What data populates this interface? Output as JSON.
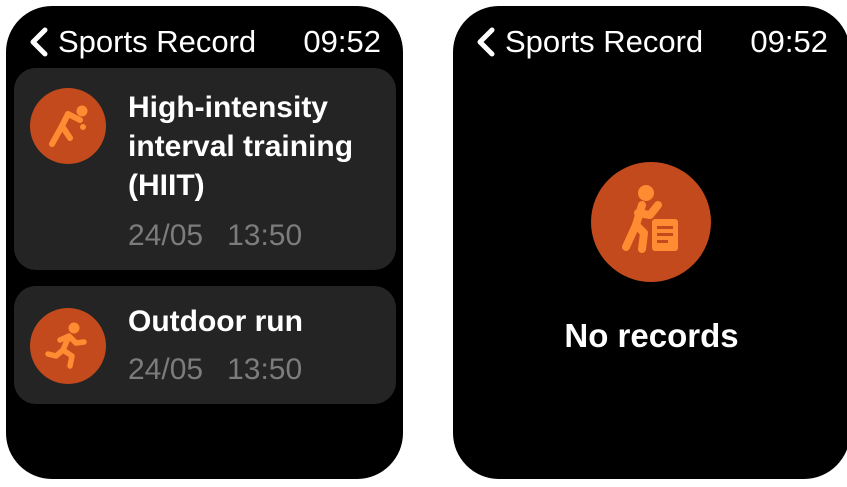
{
  "colors": {
    "icon_background": "#c24a1c",
    "icon_foreground": "#ff8c32",
    "card_background": "#242424",
    "secondary_text": "#7c7c7c"
  },
  "screens": [
    {
      "header": {
        "back_icon": "chevron-left-icon",
        "title": "Sports Record",
        "time": "09:52"
      },
      "records": [
        {
          "icon": "hiit-icon",
          "name": "High-intensity interval training (HIIT)",
          "date": "24/05",
          "time": "13:50"
        },
        {
          "icon": "outdoor-run-icon",
          "name": "Outdoor run",
          "date": "24/05",
          "time": "13:50"
        }
      ]
    },
    {
      "header": {
        "back_icon": "chevron-left-icon",
        "title": "Sports Record",
        "time": "09:52"
      },
      "empty_state": {
        "icon": "sports-record-icon",
        "message": "No records"
      }
    }
  ]
}
